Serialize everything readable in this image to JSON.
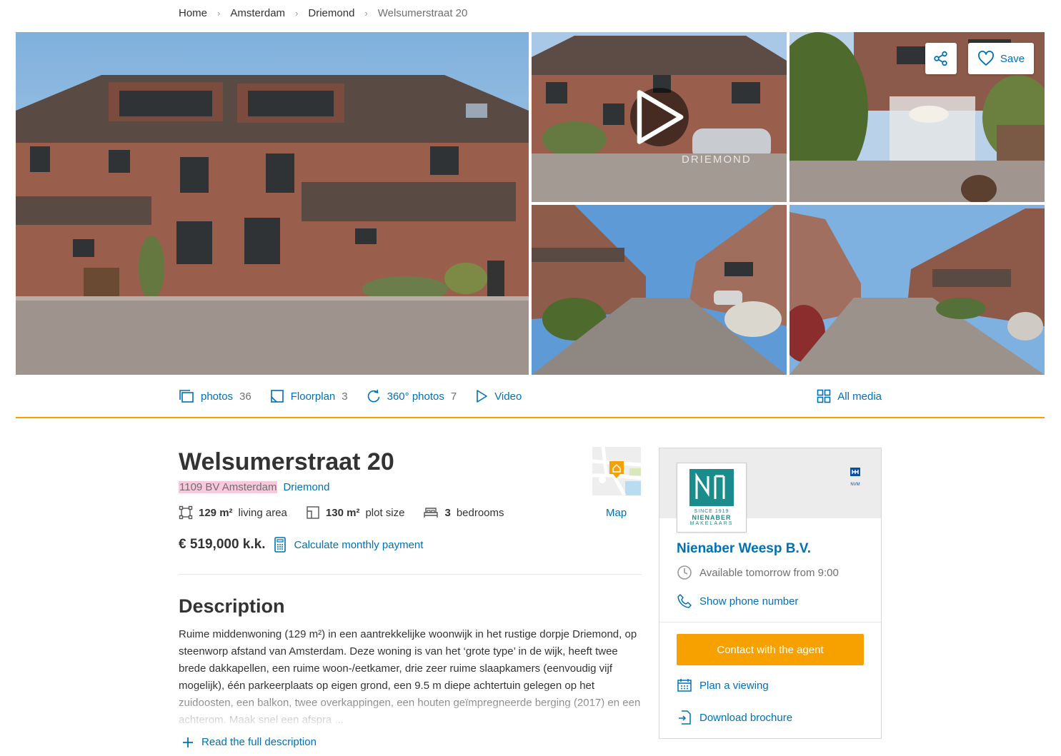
{
  "breadcrumb": {
    "items": [
      "Home",
      "Amsterdam",
      "Driemond",
      "Welsumerstraat 20"
    ]
  },
  "gallery": {
    "watermark": "DRIEMOND",
    "save_label": "Save"
  },
  "media": {
    "photos_label": "photos",
    "photos_count": "36",
    "floorplan_label": "Floorplan",
    "floorplan_count": "3",
    "photos360_label": "360° photos",
    "photos360_count": "7",
    "video_label": "Video",
    "all_media_label": "All media"
  },
  "listing": {
    "title": "Welsumerstraat 20",
    "postal": "1109 BV Amsterdam",
    "neighborhood": "Driemond",
    "living_area_value": "129 m²",
    "living_area_label": "living area",
    "plot_size_value": "130 m²",
    "plot_size_label": "plot size",
    "bedrooms_value": "3",
    "bedrooms_label": "bedrooms",
    "price": "€ 519,000 k.k.",
    "calc_label": "Calculate monthly payment",
    "map_label": "Map"
  },
  "description": {
    "title": "Description",
    "text": "Ruime middenwoning (129 m²) in een aantrekkelijke woonwijk in het rustige dorpje Driemond, op steenworp afstand van Amsterdam. Deze woning is van het ‘grote type’ in de wijk, heeft twee brede dakkapellen, een ruime woon-/eetkamer, drie zeer ruime slaapkamers (eenvoudig vijf mogelijk), één parkeerplaats op eigen grond, een 9.5 m diepe achtertuin gelegen op het zuidoosten, een balkon, twee overkappingen, een houten geïmpregneerde berging (2017) en een achterom. Maak snel een afspra ...",
    "read_more": "Read the full description"
  },
  "agent": {
    "logo_name": "NIENABER",
    "logo_sub": "MAKELAARS",
    "logo_since": "SINCE 1919",
    "nvm": "NVM",
    "name": "Nienaber Weesp B.V.",
    "availability": "Available tomorrow from 9:00",
    "phone_label": "Show phone number",
    "contact_label": "Contact with the agent",
    "viewing_label": "Plan a viewing",
    "brochure_label": "Download brochure"
  },
  "colors": {
    "accent": "#f7a100",
    "link": "#0071b3",
    "highlight": "#f8c8dc"
  }
}
